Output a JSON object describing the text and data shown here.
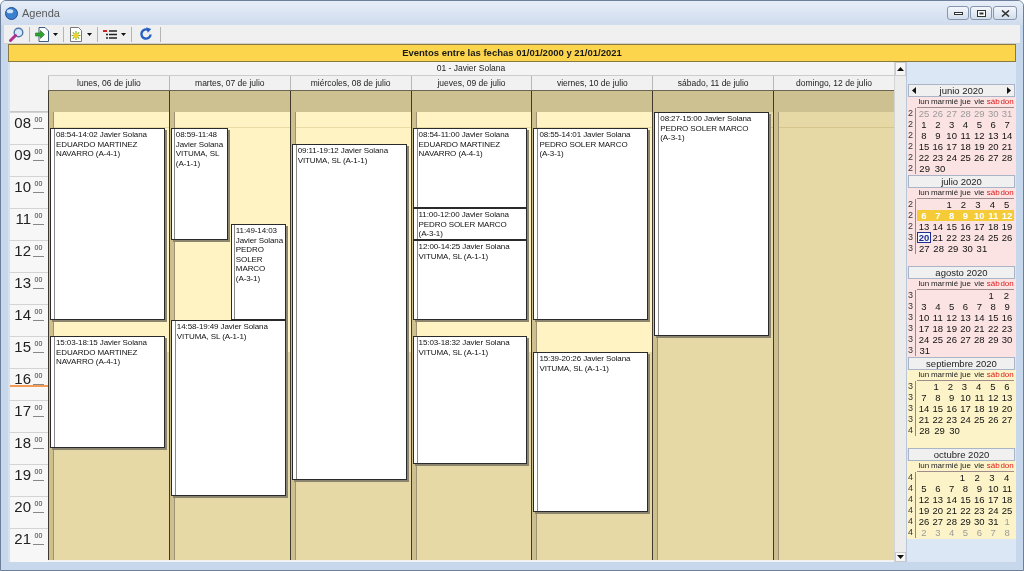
{
  "window": {
    "title": "Agenda"
  },
  "banner": "Eventos entre las fechas 01/01/2000 y 21/01/2021",
  "resource": "01 - Javier Solana",
  "hours": [
    {
      "hour": "08",
      "minutes": "00",
      "current": false
    },
    {
      "hour": "09",
      "minutes": "00",
      "current": false
    },
    {
      "hour": "10",
      "minutes": "00",
      "current": false
    },
    {
      "hour": "11",
      "minutes": "00",
      "current": false
    },
    {
      "hour": "12",
      "minutes": "00",
      "current": false
    },
    {
      "hour": "13",
      "minutes": "00",
      "current": false
    },
    {
      "hour": "14",
      "minutes": "00",
      "current": false
    },
    {
      "hour": "15",
      "minutes": "00",
      "current": false
    },
    {
      "hour": "16",
      "minutes": "00",
      "current": true
    },
    {
      "hour": "17",
      "minutes": "00",
      "current": false
    },
    {
      "hour": "18",
      "minutes": "00",
      "current": false
    },
    {
      "hour": "19",
      "minutes": "00",
      "current": false
    },
    {
      "hour": "20",
      "minutes": "00",
      "current": false
    },
    {
      "hour": "21",
      "minutes": "00",
      "current": false
    }
  ],
  "days": [
    {
      "label": "lunes, 06 de julio",
      "weekend": false,
      "events": [
        {
          "time": "08:54-14:02",
          "person": "Javier Solana",
          "client": "EDUARDO MARTINEZ NAVARRO (A-4-1)",
          "kind": "full"
        },
        {
          "time": "15:03-18:15",
          "person": "Javier Solana",
          "client": "EDUARDO MARTINEZ NAVARRO (A-4-1)",
          "kind": "full"
        }
      ]
    },
    {
      "label": "martes, 07 de julio",
      "weekend": false,
      "events": [
        {
          "time": "08:59-11:48",
          "person": "Javier Solana",
          "client": "VITUMA, SL (A-1-1)",
          "kind": "left"
        },
        {
          "time": "11:49-14:03",
          "person": "Javier Solana",
          "client": "PEDRO SOLER MARCO (A-3-1)",
          "kind": "right"
        },
        {
          "time": "14:58-19:49",
          "person": "Javier Solana",
          "client": "VITUMA, SL (A-1-1)",
          "kind": "full"
        }
      ]
    },
    {
      "label": "miércoles, 08 de julio",
      "weekend": false,
      "events": [
        {
          "time": "09:11-19:12",
          "person": "Javier Solana",
          "client": "VITUMA, SL (A-1-1)",
          "kind": "full"
        }
      ]
    },
    {
      "label": "jueves, 09 de julio",
      "weekend": false,
      "events": [
        {
          "time": "08:54-11:00",
          "person": "Javier Solana",
          "client": "EDUARDO MARTINEZ NAVARRO (A-4-1)",
          "kind": "full"
        },
        {
          "time": "11:00-12:00",
          "person": "Javier Solana",
          "client": "PEDRO SOLER MARCO (A-3-1)",
          "kind": "full"
        },
        {
          "time": "12:00-14:25",
          "person": "Javier Solana",
          "client": "VITUMA, SL (A-1-1)",
          "kind": "full"
        },
        {
          "time": "15:03-18:32",
          "person": "Javier Solana",
          "client": "VITUMA, SL (A-1-1)",
          "kind": "full"
        }
      ]
    },
    {
      "label": "viernes, 10 de julio",
      "weekend": false,
      "events": [
        {
          "time": "08:55-14:01",
          "person": "Javier Solana",
          "client": "PEDRO SOLER MARCO (A-3-1)",
          "kind": "full"
        },
        {
          "time": "15:39-20:26",
          "person": "Javier Solana",
          "client": "VITUMA, SL (A-1-1)",
          "kind": "full"
        }
      ]
    },
    {
      "label": "sábado, 11 de julio",
      "weekend": true,
      "events": [
        {
          "time": "08:27-15:00",
          "person": "Javier Solana",
          "client": "PEDRO SOLER MARCO (A-3-1)",
          "kind": "full"
        }
      ]
    },
    {
      "label": "domingo, 12 de julio",
      "weekend": true
    }
  ],
  "mini_calendars": [
    {
      "title": "junio 2020",
      "arrows": true,
      "color": "#fce3e3",
      "day_names": [
        {
          "text": "lun",
          "weekend": false
        },
        {
          "text": "mar",
          "weekend": false
        },
        {
          "text": "mié",
          "weekend": false
        },
        {
          "text": "jue",
          "weekend": false
        },
        {
          "text": "vie",
          "weekend": false
        },
        {
          "text": "sáb",
          "weekend": true
        },
        {
          "text": "don",
          "weekend": true
        }
      ],
      "weeks": [
        {
          "number": "2",
          "selected": false,
          "days": [
            {
              "day": "25",
              "kind": "other"
            },
            {
              "day": "26",
              "kind": "other"
            },
            {
              "day": "27",
              "kind": "other"
            },
            {
              "day": "28",
              "kind": "other"
            },
            {
              "day": "29",
              "kind": "other"
            },
            {
              "day": "30",
              "kind": "other"
            },
            {
              "day": "31",
              "kind": "other"
            }
          ]
        },
        {
          "number": "2",
          "selected": false,
          "days": [
            {
              "day": "1",
              "kind": "day"
            },
            {
              "day": "2",
              "kind": "day"
            },
            {
              "day": "3",
              "kind": "day"
            },
            {
              "day": "4",
              "kind": "day"
            },
            {
              "day": "5",
              "kind": "day"
            },
            {
              "day": "6",
              "kind": "day"
            },
            {
              "day": "7",
              "kind": "day"
            }
          ]
        },
        {
          "number": "2",
          "selected": false,
          "days": [
            {
              "day": "8",
              "kind": "day"
            },
            {
              "day": "9",
              "kind": "day"
            },
            {
              "day": "10",
              "kind": "day"
            },
            {
              "day": "11",
              "kind": "day"
            },
            {
              "day": "12",
              "kind": "day"
            },
            {
              "day": "13",
              "kind": "day"
            },
            {
              "day": "14",
              "kind": "day"
            }
          ]
        },
        {
          "number": "2",
          "selected": false,
          "days": [
            {
              "day": "15",
              "kind": "day"
            },
            {
              "day": "16",
              "kind": "day"
            },
            {
              "day": "17",
              "kind": "day"
            },
            {
              "day": "18",
              "kind": "day"
            },
            {
              "day": "19",
              "kind": "day"
            },
            {
              "day": "20",
              "kind": "day"
            },
            {
              "day": "21",
              "kind": "day"
            }
          ]
        },
        {
          "number": "2",
          "selected": false,
          "days": [
            {
              "day": "22",
              "kind": "day"
            },
            {
              "day": "23",
              "kind": "day"
            },
            {
              "day": "24",
              "kind": "day"
            },
            {
              "day": "25",
              "kind": "day"
            },
            {
              "day": "26",
              "kind": "day"
            },
            {
              "day": "27",
              "kind": "day"
            },
            {
              "day": "28",
              "kind": "day"
            }
          ]
        },
        {
          "number": "2",
          "selected": false,
          "days": [
            {
              "day": "29",
              "kind": "day"
            },
            {
              "day": "30",
              "kind": "day"
            }
          ]
        }
      ]
    },
    {
      "title": "julio 2020",
      "arrows": false,
      "color": "#fce3e3",
      "day_names": [
        {
          "text": "lun",
          "weekend": false
        },
        {
          "text": "mar",
          "weekend": false
        },
        {
          "text": "mié",
          "weekend": false
        },
        {
          "text": "jue",
          "weekend": false
        },
        {
          "text": "vie",
          "weekend": false
        },
        {
          "text": "sáb",
          "weekend": true
        },
        {
          "text": "don",
          "weekend": true
        }
      ],
      "weeks": [
        {
          "number": "2",
          "selected": false,
          "days": [
            {
              "day": "1",
              "kind": "day"
            },
            {
              "day": "2",
              "kind": "day"
            },
            {
              "day": "3",
              "kind": "day"
            },
            {
              "day": "4",
              "kind": "day"
            },
            {
              "day": "5",
              "kind": "day"
            }
          ]
        },
        {
          "number": "2",
          "selected": true,
          "days": [
            {
              "day": "6",
              "kind": "day"
            },
            {
              "day": "7",
              "kind": "day"
            },
            {
              "day": "8",
              "kind": "day"
            },
            {
              "day": "9",
              "kind": "day"
            },
            {
              "day": "10",
              "kind": "day"
            },
            {
              "day": "11",
              "kind": "day"
            },
            {
              "day": "12",
              "kind": "day"
            }
          ]
        },
        {
          "number": "2",
          "selected": false,
          "days": [
            {
              "day": "13",
              "kind": "day"
            },
            {
              "day": "14",
              "kind": "day"
            },
            {
              "day": "15",
              "kind": "day"
            },
            {
              "day": "16",
              "kind": "day"
            },
            {
              "day": "17",
              "kind": "day"
            },
            {
              "day": "18",
              "kind": "day"
            },
            {
              "day": "19",
              "kind": "day"
            }
          ]
        },
        {
          "number": "3",
          "selected": false,
          "days": [
            {
              "day": "20",
              "kind": "today"
            },
            {
              "day": "21",
              "kind": "day"
            },
            {
              "day": "22",
              "kind": "day"
            },
            {
              "day": "23",
              "kind": "day"
            },
            {
              "day": "24",
              "kind": "day"
            },
            {
              "day": "25",
              "kind": "day"
            },
            {
              "day": "26",
              "kind": "day"
            }
          ]
        },
        {
          "number": "3",
          "selected": false,
          "days": [
            {
              "day": "27",
              "kind": "day"
            },
            {
              "day": "28",
              "kind": "day"
            },
            {
              "day": "29",
              "kind": "day"
            },
            {
              "day": "30",
              "kind": "day"
            },
            {
              "day": "31",
              "kind": "day"
            }
          ]
        }
      ]
    },
    {
      "title": "agosto 2020",
      "arrows": false,
      "color": "#fce3e3",
      "day_names": [
        {
          "text": "lun",
          "weekend": false
        },
        {
          "text": "mar",
          "weekend": false
        },
        {
          "text": "mié",
          "weekend": false
        },
        {
          "text": "jue",
          "weekend": false
        },
        {
          "text": "vie",
          "weekend": false
        },
        {
          "text": "sáb",
          "weekend": true
        },
        {
          "text": "don",
          "weekend": true
        }
      ],
      "weeks": [
        {
          "number": "3",
          "selected": false,
          "days": [
            {
              "day": "1",
              "kind": "day"
            },
            {
              "day": "2",
              "kind": "day"
            }
          ]
        },
        {
          "number": "3",
          "selected": false,
          "days": [
            {
              "day": "3",
              "kind": "day"
            },
            {
              "day": "4",
              "kind": "day"
            },
            {
              "day": "5",
              "kind": "day"
            },
            {
              "day": "6",
              "kind": "day"
            },
            {
              "day": "7",
              "kind": "day"
            },
            {
              "day": "8",
              "kind": "day"
            },
            {
              "day": "9",
              "kind": "day"
            }
          ]
        },
        {
          "number": "3",
          "selected": false,
          "days": [
            {
              "day": "10",
              "kind": "day"
            },
            {
              "day": "11",
              "kind": "day"
            },
            {
              "day": "12",
              "kind": "day"
            },
            {
              "day": "13",
              "kind": "day"
            },
            {
              "day": "14",
              "kind": "day"
            },
            {
              "day": "15",
              "kind": "day"
            },
            {
              "day": "16",
              "kind": "day"
            }
          ]
        },
        {
          "number": "3",
          "selected": false,
          "days": [
            {
              "day": "17",
              "kind": "day"
            },
            {
              "day": "18",
              "kind": "day"
            },
            {
              "day": "19",
              "kind": "day"
            },
            {
              "day": "20",
              "kind": "day"
            },
            {
              "day": "21",
              "kind": "day"
            },
            {
              "day": "22",
              "kind": "day"
            },
            {
              "day": "23",
              "kind": "day"
            }
          ]
        },
        {
          "number": "3",
          "selected": false,
          "days": [
            {
              "day": "24",
              "kind": "day"
            },
            {
              "day": "25",
              "kind": "day"
            },
            {
              "day": "26",
              "kind": "day"
            },
            {
              "day": "27",
              "kind": "day"
            },
            {
              "day": "28",
              "kind": "day"
            },
            {
              "day": "29",
              "kind": "day"
            },
            {
              "day": "30",
              "kind": "day"
            }
          ]
        },
        {
          "number": "3",
          "selected": false,
          "days": [
            {
              "day": "31",
              "kind": "day"
            }
          ]
        }
      ]
    },
    {
      "title": "septiembre 2020",
      "arrows": false,
      "color": "#fcf4c8",
      "day_names": [
        {
          "text": "lun",
          "weekend": false
        },
        {
          "text": "mar",
          "weekend": false
        },
        {
          "text": "mié",
          "weekend": false
        },
        {
          "text": "jue",
          "weekend": false
        },
        {
          "text": "vie",
          "weekend": false
        },
        {
          "text": "sáb",
          "weekend": true
        },
        {
          "text": "don",
          "weekend": true
        }
      ],
      "weeks": [
        {
          "number": "3",
          "selected": false,
          "days": [
            {
              "day": "1",
              "kind": "day"
            },
            {
              "day": "2",
              "kind": "day"
            },
            {
              "day": "3",
              "kind": "day"
            },
            {
              "day": "4",
              "kind": "day"
            },
            {
              "day": "5",
              "kind": "day"
            },
            {
              "day": "6",
              "kind": "day"
            }
          ]
        },
        {
          "number": "3",
          "selected": false,
          "days": [
            {
              "day": "7",
              "kind": "day"
            },
            {
              "day": "8",
              "kind": "day"
            },
            {
              "day": "9",
              "kind": "day"
            },
            {
              "day": "10",
              "kind": "day"
            },
            {
              "day": "11",
              "kind": "day"
            },
            {
              "day": "12",
              "kind": "day"
            },
            {
              "day": "13",
              "kind": "day"
            }
          ]
        },
        {
          "number": "3",
          "selected": false,
          "days": [
            {
              "day": "14",
              "kind": "day"
            },
            {
              "day": "15",
              "kind": "day"
            },
            {
              "day": "16",
              "kind": "day"
            },
            {
              "day": "17",
              "kind": "day"
            },
            {
              "day": "18",
              "kind": "day"
            },
            {
              "day": "19",
              "kind": "day"
            },
            {
              "day": "20",
              "kind": "day"
            }
          ]
        },
        {
          "number": "3",
          "selected": false,
          "days": [
            {
              "day": "21",
              "kind": "day"
            },
            {
              "day": "22",
              "kind": "day"
            },
            {
              "day": "23",
              "kind": "day"
            },
            {
              "day": "24",
              "kind": "day"
            },
            {
              "day": "25",
              "kind": "day"
            },
            {
              "day": "26",
              "kind": "day"
            },
            {
              "day": "27",
              "kind": "day"
            }
          ]
        },
        {
          "number": "4",
          "selected": false,
          "days": [
            {
              "day": "28",
              "kind": "day"
            },
            {
              "day": "29",
              "kind": "day"
            },
            {
              "day": "30",
              "kind": "day"
            }
          ]
        }
      ]
    },
    {
      "title": "octubre 2020",
      "arrows": false,
      "color": "#fcf4c8",
      "day_names": [
        {
          "text": "lun",
          "weekend": false
        },
        {
          "text": "mar",
          "weekend": false
        },
        {
          "text": "mié",
          "weekend": false
        },
        {
          "text": "jue",
          "weekend": false
        },
        {
          "text": "vie",
          "weekend": false
        },
        {
          "text": "sáb",
          "weekend": true
        },
        {
          "text": "don",
          "weekend": true
        }
      ],
      "weeks": [
        {
          "number": "4",
          "selected": false,
          "days": [
            {
              "day": "1",
              "kind": "day"
            },
            {
              "day": "2",
              "kind": "day"
            },
            {
              "day": "3",
              "kind": "day"
            },
            {
              "day": "4",
              "kind": "day"
            }
          ]
        },
        {
          "number": "4",
          "selected": false,
          "days": [
            {
              "day": "5",
              "kind": "day"
            },
            {
              "day": "6",
              "kind": "day"
            },
            {
              "day": "7",
              "kind": "day"
            },
            {
              "day": "8",
              "kind": "day"
            },
            {
              "day": "9",
              "kind": "day"
            },
            {
              "day": "10",
              "kind": "day"
            },
            {
              "day": "11",
              "kind": "day"
            }
          ]
        },
        {
          "number": "4",
          "selected": false,
          "days": [
            {
              "day": "12",
              "kind": "day"
            },
            {
              "day": "13",
              "kind": "day"
            },
            {
              "day": "14",
              "kind": "day"
            },
            {
              "day": "15",
              "kind": "day"
            },
            {
              "day": "16",
              "kind": "day"
            },
            {
              "day": "17",
              "kind": "day"
            },
            {
              "day": "18",
              "kind": "day"
            }
          ]
        },
        {
          "number": "4",
          "selected": false,
          "days": [
            {
              "day": "19",
              "kind": "day"
            },
            {
              "day": "20",
              "kind": "day"
            },
            {
              "day": "21",
              "kind": "day"
            },
            {
              "day": "22",
              "kind": "day"
            },
            {
              "day": "23",
              "kind": "day"
            },
            {
              "day": "24",
              "kind": "day"
            },
            {
              "day": "25",
              "kind": "day"
            }
          ]
        },
        {
          "number": "4",
          "selected": false,
          "days": [
            {
              "day": "26",
              "kind": "day"
            },
            {
              "day": "27",
              "kind": "day"
            },
            {
              "day": "28",
              "kind": "day"
            },
            {
              "day": "29",
              "kind": "day"
            },
            {
              "day": "30",
              "kind": "day"
            },
            {
              "day": "31",
              "kind": "day"
            },
            {
              "day": "1",
              "kind": "other"
            }
          ]
        },
        {
          "number": "4",
          "selected": false,
          "days": [
            {
              "day": "2",
              "kind": "other"
            },
            {
              "day": "3",
              "kind": "other"
            },
            {
              "day": "4",
              "kind": "other"
            },
            {
              "day": "5",
              "kind": "other"
            },
            {
              "day": "6",
              "kind": "other"
            },
            {
              "day": "7",
              "kind": "other"
            },
            {
              "day": "8",
              "kind": "other"
            }
          ]
        }
      ]
    }
  ]
}
